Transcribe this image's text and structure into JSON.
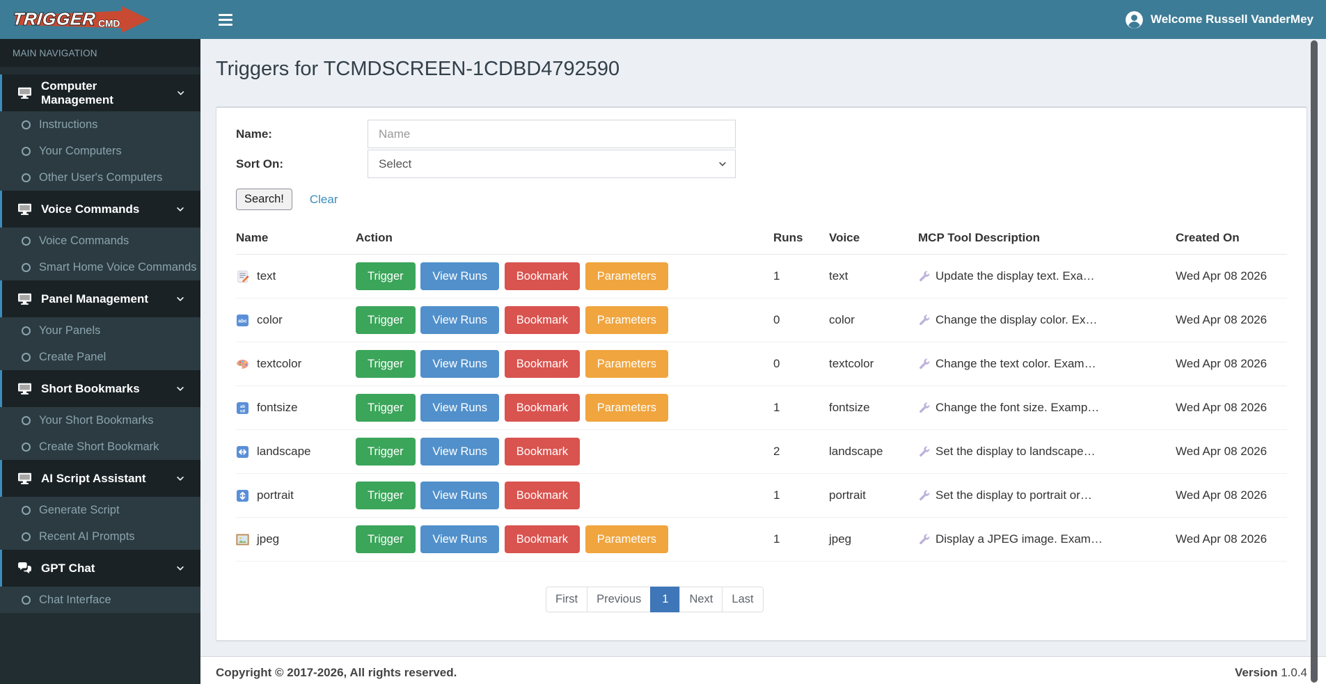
{
  "header": {
    "brand": {
      "trigger": "TRIGGER",
      "cmd": "CMD"
    },
    "welcome_text": "Welcome Russell VanderMey"
  },
  "sidebar": {
    "section_label": "MAIN NAVIGATION",
    "groups": [
      {
        "label": "Computer Management",
        "icon": "desktop-icon",
        "children": [
          "Instructions",
          "Your Computers",
          "Other User's Computers"
        ]
      },
      {
        "label": "Voice Commands",
        "icon": "desktop-icon",
        "children": [
          "Voice Commands",
          "Smart Home Voice Commands"
        ]
      },
      {
        "label": "Panel Management",
        "icon": "desktop-icon",
        "children": [
          "Your Panels",
          "Create Panel"
        ]
      },
      {
        "label": "Short Bookmarks",
        "icon": "desktop-icon",
        "children": [
          "Your Short Bookmarks",
          "Create Short Bookmark"
        ]
      },
      {
        "label": "AI Script Assistant",
        "icon": "desktop-icon",
        "children": [
          "Generate Script",
          "Recent AI Prompts"
        ]
      },
      {
        "label": "GPT Chat",
        "icon": "comments-icon",
        "children": [
          "Chat Interface"
        ]
      }
    ]
  },
  "main": {
    "page_title": "Triggers for TCMDSCREEN-1CDBD4792590",
    "search_form": {
      "name_label": "Name:",
      "name_placeholder": "Name",
      "name_value": "",
      "sort_label": "Sort On:",
      "sort_value": "Select",
      "search_button": "Search!",
      "clear_link": "Clear"
    },
    "table": {
      "columns": [
        "Name",
        "Action",
        "Runs",
        "Voice",
        "MCP Tool Description",
        "Created On"
      ],
      "action_labels": {
        "trigger": "Trigger",
        "view_runs": "View Runs",
        "bookmark": "Bookmark",
        "parameters": "Parameters"
      },
      "rows": [
        {
          "name": "text",
          "icon": "memo-icon",
          "runs": "1",
          "voice": "text",
          "description": "Update the display text. Exa…",
          "created_on": "Wed Apr 08 2026",
          "has_parameters": true
        },
        {
          "name": "color",
          "icon": "abc-icon",
          "runs": "0",
          "voice": "color",
          "description": "Change the display color. Ex…",
          "created_on": "Wed Apr 08 2026",
          "has_parameters": true
        },
        {
          "name": "textcolor",
          "icon": "palette-icon",
          "runs": "0",
          "voice": "textcolor",
          "description": "Change the text color. Exam…",
          "created_on": "Wed Apr 08 2026",
          "has_parameters": true
        },
        {
          "name": "fontsize",
          "icon": "abcd-icon",
          "runs": "1",
          "voice": "fontsize",
          "description": "Change the font size. Examp…",
          "created_on": "Wed Apr 08 2026",
          "has_parameters": true
        },
        {
          "name": "landscape",
          "icon": "left-right-arrow-icon",
          "runs": "2",
          "voice": "landscape",
          "description": "Set the display to landscape…",
          "created_on": "Wed Apr 08 2026",
          "has_parameters": false
        },
        {
          "name": "portrait",
          "icon": "up-down-arrow-icon",
          "runs": "1",
          "voice": "portrait",
          "description": "Set the display to portrait or…",
          "created_on": "Wed Apr 08 2026",
          "has_parameters": false
        },
        {
          "name": "jpeg",
          "icon": "framed-picture-icon",
          "runs": "1",
          "voice": "jpeg",
          "description": "Display a JPEG image. Exam…",
          "created_on": "Wed Apr 08 2026",
          "has_parameters": true
        }
      ]
    },
    "pagination": {
      "first": "First",
      "previous": "Previous",
      "current": "1",
      "next": "Next",
      "last": "Last"
    }
  },
  "footer": {
    "copyright": "Copyright © 2017-2026, All rights reserved.",
    "version_label": "Version",
    "version_value": "1.0.4"
  },
  "colors": {
    "header_teal": "#3d7c96",
    "logo_red": "#c84a32",
    "sidebar_dark": "#222d32",
    "sidebar_submenu": "#2c3b41",
    "sidebar_parent": "#1a2226",
    "active_border": "#3c8dbc",
    "green": "#3ba55a",
    "blue": "#5190cb",
    "red": "#d9534f",
    "orange": "#f0a53e",
    "link": "#3c8dbc",
    "pagination_active": "#3f76b8",
    "content_bg": "#ecf0f5"
  }
}
